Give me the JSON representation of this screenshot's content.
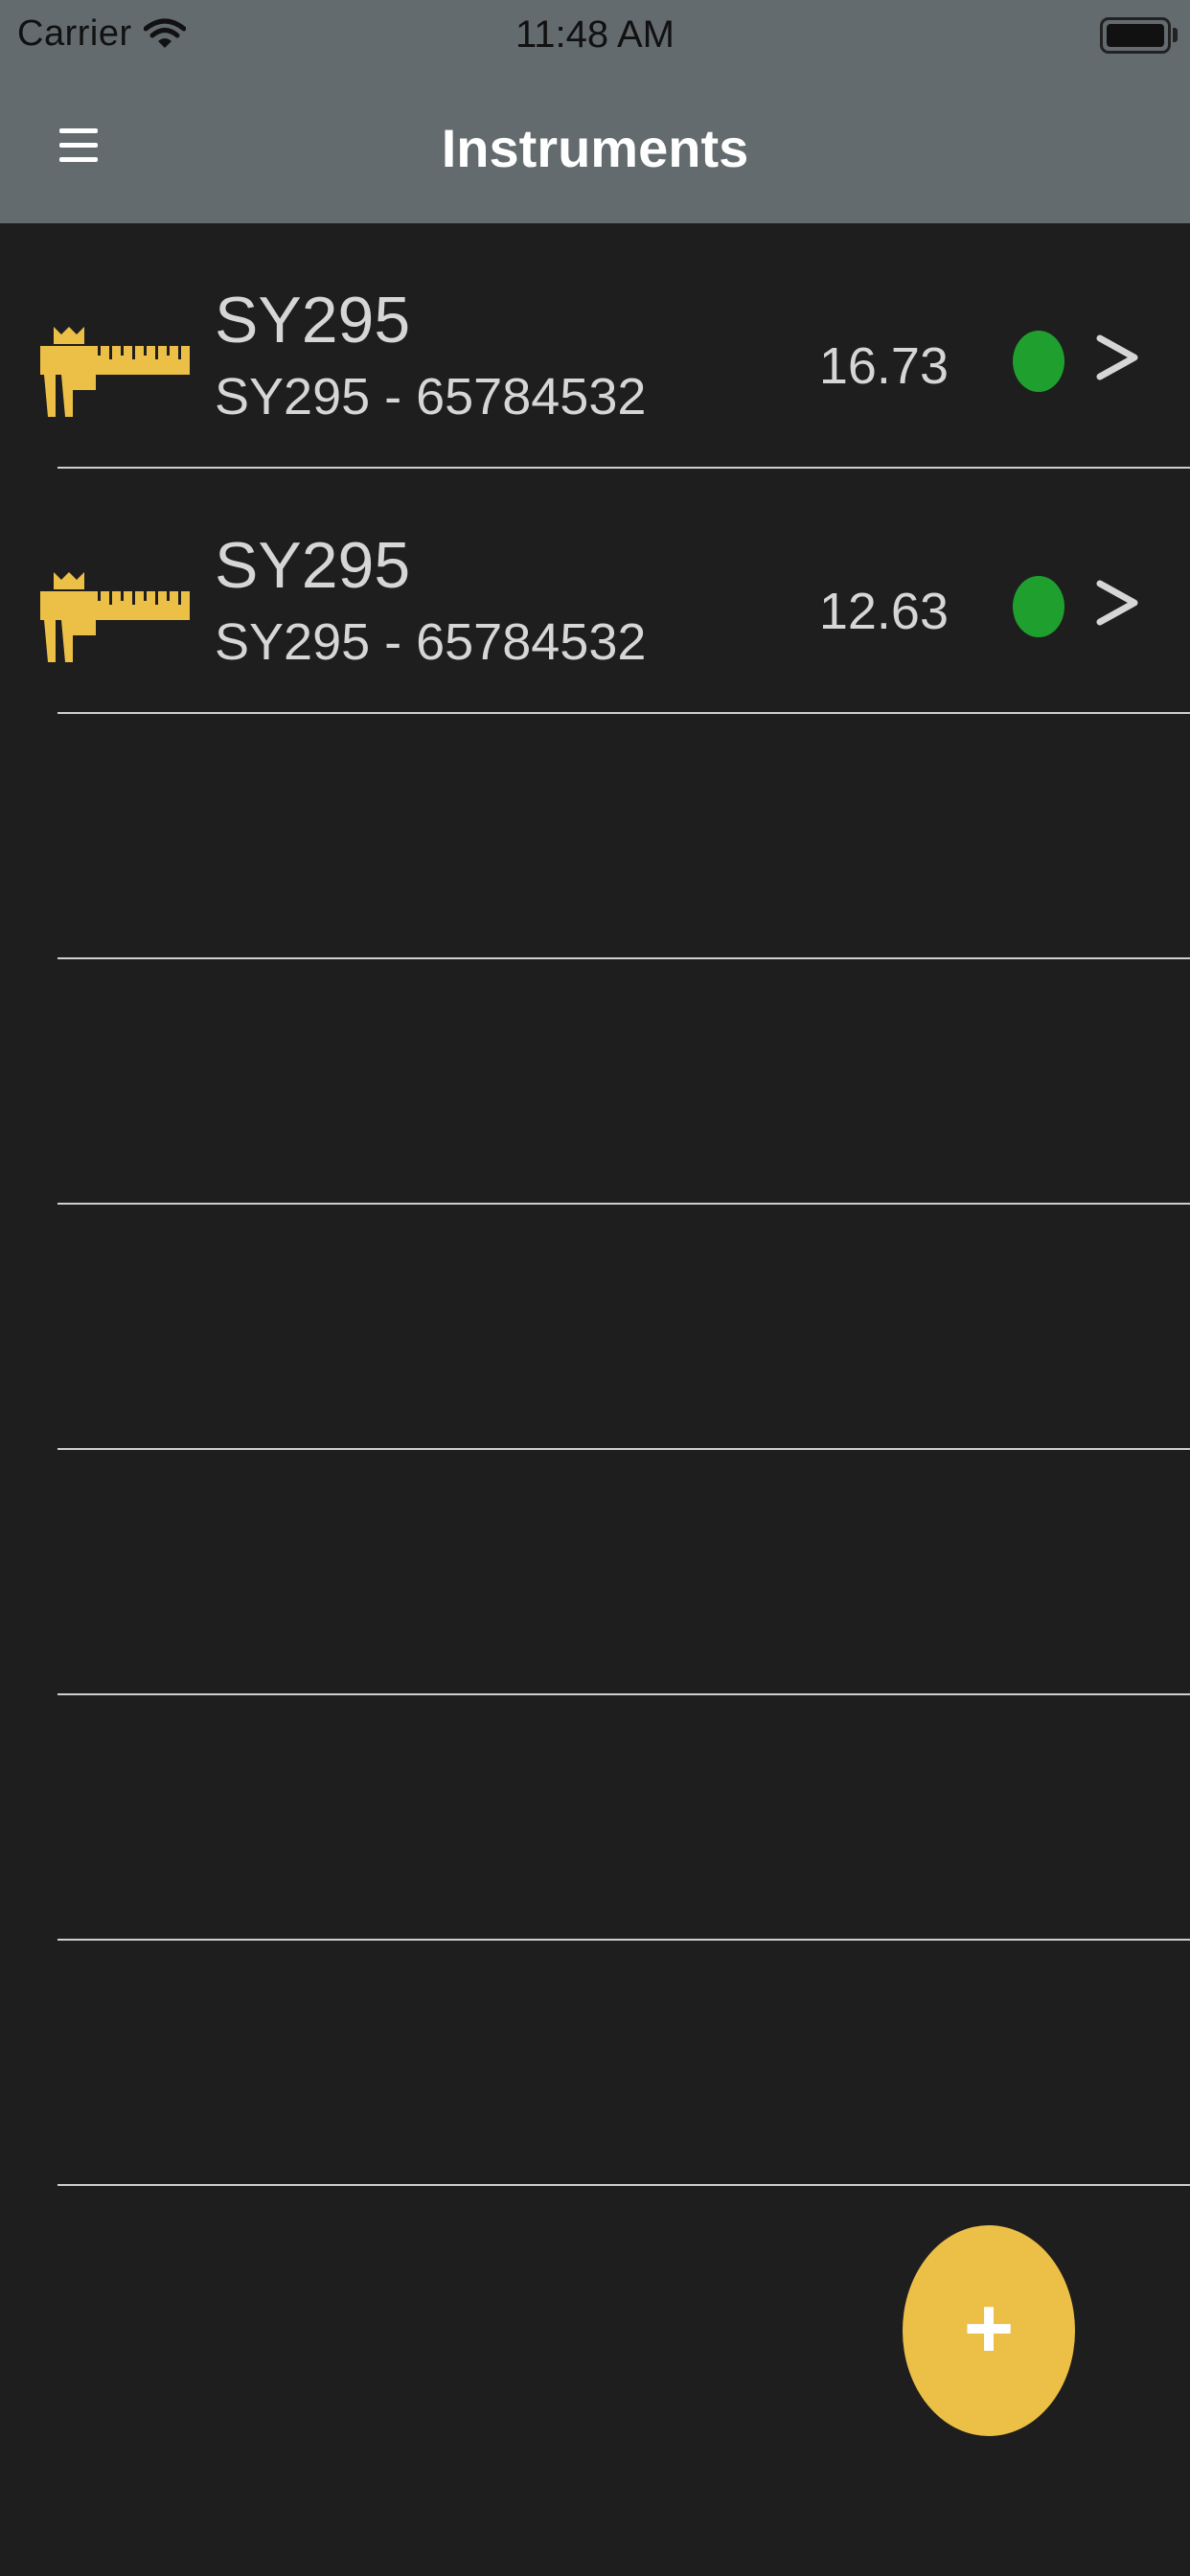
{
  "status_bar": {
    "carrier": "Carrier",
    "time": "11:48 AM",
    "wifi_icon": "wifi-icon",
    "battery_icon": "battery-icon"
  },
  "nav": {
    "title": "Instruments",
    "menu_icon": "hamburger-menu-icon"
  },
  "instruments": [
    {
      "name": "SY295",
      "subtitle": "SY295 - 65784532",
      "value": "16.73",
      "status_color": "#1fa02e",
      "icon": "caliper-icon"
    },
    {
      "name": "SY295",
      "subtitle": "SY295 - 65784532",
      "value": "12.63",
      "status_color": "#1fa02e",
      "icon": "caliper-icon"
    }
  ],
  "fab": {
    "label": "+",
    "color": "#ecbf47"
  },
  "colors": {
    "background": "#1e1e1e",
    "header": "#636b6f",
    "accent": "#ecbf47",
    "status_ok": "#1fa02e",
    "text": "#d6d6d6"
  }
}
